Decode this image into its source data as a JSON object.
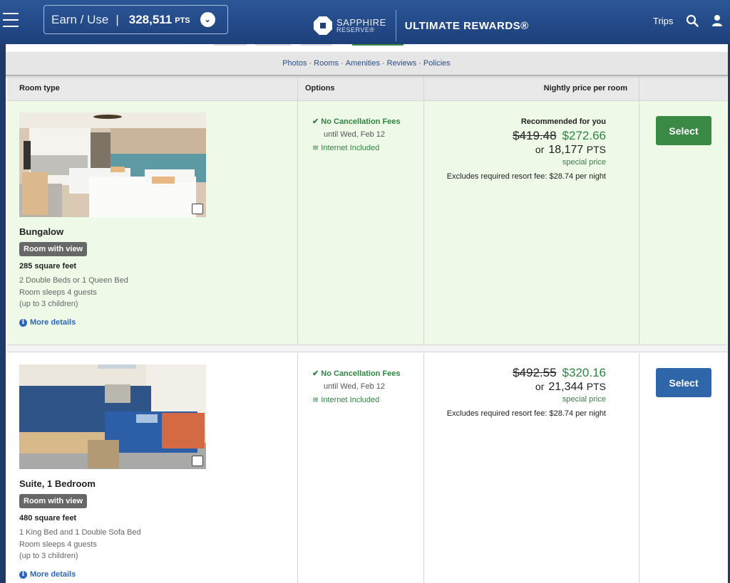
{
  "header": {
    "earn_use_label": "Earn / Use",
    "separator": "|",
    "points_balance": "328,511",
    "points_unit": "PTS",
    "brand_top": "SAPPHIRE",
    "brand_bottom": "RESERVE®",
    "program_name": "ULTIMATE REWARDS®",
    "trips_label": "Trips",
    "icons": [
      "menu-icon",
      "chevron-down-icon",
      "chase-octagon-logo",
      "search-icon",
      "user-icon"
    ]
  },
  "subnav": {
    "links": [
      "Photos",
      "Rooms",
      "Amenities",
      "Reviews",
      "Policies"
    ],
    "separator": "·"
  },
  "table_header": {
    "room_type": "Room type",
    "options": "Options",
    "nightly_price": "Nightly price per room"
  },
  "rooms": [
    {
      "name": "Bungalow",
      "badge": "Room with view",
      "size": "285 square feet",
      "beds": "2 Double Beds or 1 Queen Bed",
      "sleeps": "Room sleeps 4 guests",
      "children": "(up to 3 children)",
      "more_details": "More details",
      "option_cancel": "No Cancellation Fees",
      "option_until": "until Wed, Feb 12",
      "option_internet": "Internet Included",
      "recommended": "Recommended for you",
      "old_price": "$419.48",
      "new_price": "$272.66",
      "or_label": "or",
      "points": "18,177",
      "points_unit": "PTS",
      "special": "special price",
      "fee": "Excludes required resort fee: $28.74 per night",
      "select_label": "Select",
      "select_color": "#3a8a45"
    },
    {
      "name": "Suite, 1 Bedroom",
      "badge": "Room with view",
      "size": "480 square feet",
      "beds": "1 King Bed and 1 Double Sofa Bed",
      "sleeps": "Room sleeps 4 guests",
      "children": "(up to 3 children)",
      "more_details": "More details",
      "option_cancel": "No Cancellation Fees",
      "option_until": "until Wed, Feb 12",
      "option_internet": "Internet Included",
      "old_price": "$492.55",
      "new_price": "$320.16",
      "or_label": "or",
      "points": "21,344",
      "points_unit": "PTS",
      "special": "special price",
      "fee": "Excludes required resort fee: $28.74 per night",
      "select_label": "Select",
      "select_color": "#2f66aa"
    }
  ],
  "colors": {
    "header_blue": "#1d3f7a",
    "accent_green": "#2e8540",
    "link_blue": "#2b66c0",
    "recommended_bg": "#eef9e8"
  }
}
